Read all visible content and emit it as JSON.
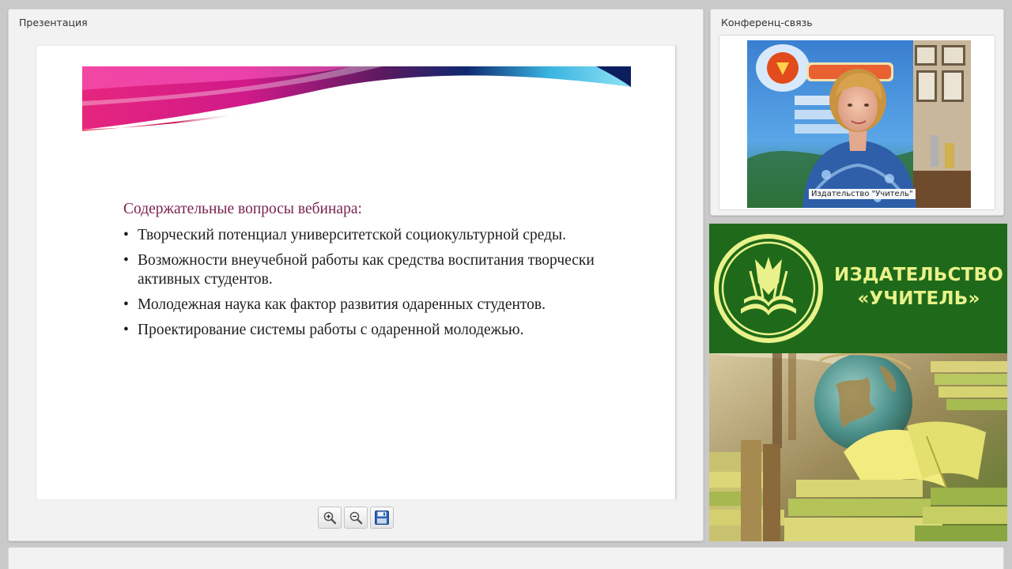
{
  "presentation": {
    "title": "Презентация",
    "slide": {
      "heading": "Содержательные вопросы вебинара:",
      "bullets": [
        "Творческий потенциал университетской социокультурной среды.",
        "Возможности внеучебной работы как средства воспитания творчески активных студентов.",
        "Молодежная наука как фактор развития одаренных студентов.",
        "Проектирование системы работы с одаренной молодежью."
      ]
    },
    "toolbar": {
      "zoom_in_icon": "zoom-in-icon",
      "zoom_out_icon": "zoom-out-icon",
      "save_icon": "floppy-disk-icon"
    }
  },
  "conference": {
    "title": "Конференц-связь",
    "participant_label": "Издательство \"Учитель\""
  },
  "brand": {
    "name_line1": "ИЗДАТЕЛЬСТВО",
    "name_line2": "«УЧИТЕЛЬ»",
    "colors": {
      "green": "#1f6a1a",
      "lettering": "#e9f28a"
    }
  }
}
